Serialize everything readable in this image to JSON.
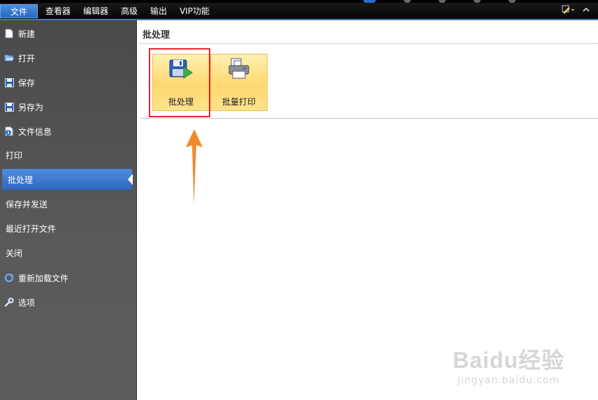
{
  "menubar": {
    "items": [
      "文件",
      "查看器",
      "编辑器",
      "高级",
      "输出",
      "VIP功能"
    ]
  },
  "sidebar": {
    "items": [
      {
        "label": "新建",
        "icon": "new-file-icon"
      },
      {
        "label": "打开",
        "icon": "folder-open-icon"
      },
      {
        "label": "保存",
        "icon": "save-icon"
      },
      {
        "label": "另存为",
        "icon": "save-as-icon"
      },
      {
        "label": "文件信息",
        "icon": "info-icon"
      },
      {
        "label": "打印",
        "icon": ""
      },
      {
        "label": "批处理",
        "icon": "",
        "active": true
      },
      {
        "label": "保存并发送",
        "icon": ""
      },
      {
        "label": "最近打开文件",
        "icon": ""
      },
      {
        "label": "关闭",
        "icon": ""
      },
      {
        "label": "重新加载文件",
        "icon": "reload-icon"
      },
      {
        "label": "选项",
        "icon": "wrench-icon"
      }
    ]
  },
  "main": {
    "title": "批处理",
    "tiles": [
      {
        "label": "批处理",
        "icon": "batch-process-icon"
      },
      {
        "label": "批量打印",
        "icon": "batch-print-icon"
      }
    ]
  },
  "watermark": {
    "line1": "Baidu经验",
    "line2": "jingyan.baidu.com"
  },
  "colors": {
    "accent": "#2e66bd",
    "tile": "#ffd870",
    "highlight_box": "#e0272a",
    "arrow": "#f08a2e"
  }
}
